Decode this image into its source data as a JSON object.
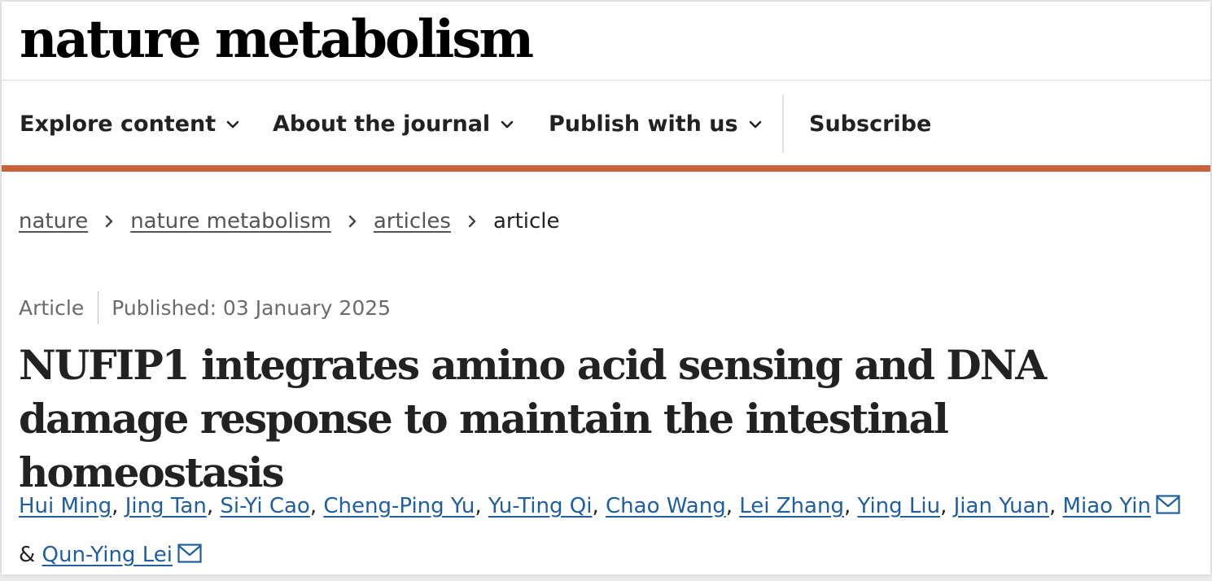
{
  "logo": "nature metabolism",
  "nav": {
    "explore": "Explore content",
    "about": "About the journal",
    "publish": "Publish with us",
    "subscribe": "Subscribe"
  },
  "breadcrumb": {
    "items": [
      "nature",
      "nature metabolism",
      "articles"
    ],
    "current": "article",
    "separator": "›"
  },
  "meta": {
    "type": "Article",
    "published": "Published: 03 January 2025"
  },
  "headline": "NUFIP1 integrates amino acid sensing and DNA damage response to maintain the intestinal homeostasis",
  "authors": {
    "names": [
      "Hui Ming",
      "Jing Tan",
      "Si-Yi Cao",
      "Cheng-Ping Yu",
      "Yu-Ting Qi",
      "Chao Wang",
      "Lei Zhang",
      "Ying Liu",
      "Jian Yuan",
      "Miao Yin",
      "Qun-Ying Lei"
    ],
    "comma": ",",
    "ampersand": "&"
  },
  "colors": {
    "accent_rule": "#c8643c",
    "link": "#1f5ea0",
    "text": "#222222"
  },
  "icons": {
    "nav_chevron": "chevron-down-icon",
    "breadcrumb_separator": "chevron-right-icon",
    "corresponding_author": "mail-icon"
  }
}
